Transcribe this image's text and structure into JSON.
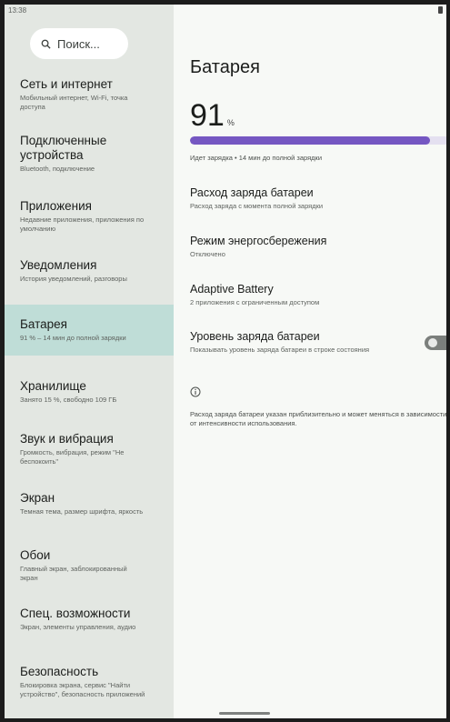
{
  "status_bar": {
    "time": "13:38"
  },
  "search": {
    "placeholder": "Поиск..."
  },
  "sidebar": {
    "items": [
      {
        "title": "Сеть и интернет",
        "subtitle": "Мобильный интернет, Wi-Fi, точка доступа"
      },
      {
        "title": "Подключенные устройства",
        "subtitle": "Bluetooth, подключение"
      },
      {
        "title": "Приложения",
        "subtitle": "Недавние приложения, приложения по умолчанию"
      },
      {
        "title": "Уведомления",
        "subtitle": "История уведомлений, разговоры"
      },
      {
        "title": "Батарея",
        "subtitle": "91 % – 14 мин до полной зарядки"
      },
      {
        "title": "Хранилище",
        "subtitle": "Занято 15 %, свободно 109 ГБ"
      },
      {
        "title": "Звук и вибрация",
        "subtitle": "Громкость, вибрация, режим \"Не беспокоить\""
      },
      {
        "title": "Экран",
        "subtitle": "Темная тема, размер шрифта, яркость"
      },
      {
        "title": "Обои",
        "subtitle": "Главный экран, заблокированный экран"
      },
      {
        "title": "Спец. возможности",
        "subtitle": "Экран, элементы управления, аудио"
      },
      {
        "title": "Безопасность",
        "subtitle": "Блокировка экрана, сервис \"Найти устройство\", безопасность приложений"
      }
    ],
    "active_index": 4
  },
  "content": {
    "title": "Батарея",
    "level_value": "91",
    "level_unit": "%",
    "level_fraction": 0.91,
    "charge_status": "Идет зарядка • 14 мин до полной зарядки",
    "items": [
      {
        "title": "Расход заряда батареи",
        "subtitle": "Расход заряда с момента полной зарядки"
      },
      {
        "title": "Режим энергосбережения",
        "subtitle": "Отключено"
      },
      {
        "title": "Adaptive Battery",
        "subtitle": "2 приложения с ограниченным доступом"
      },
      {
        "title": "Уровень заряда батареи",
        "subtitle": "Показывать уровень заряда батареи в строке состояния"
      }
    ],
    "battery_percentage_toggle": false,
    "footnote": "Расход заряда батареи указан приблизительно и может меняться в зависимости от интенсивности использования."
  },
  "colors": {
    "accent": "#7557c2",
    "sidebar_bg": "#e3e7e2",
    "active_item_bg": "#bfddd7",
    "page_bg": "#f7f9f6"
  }
}
